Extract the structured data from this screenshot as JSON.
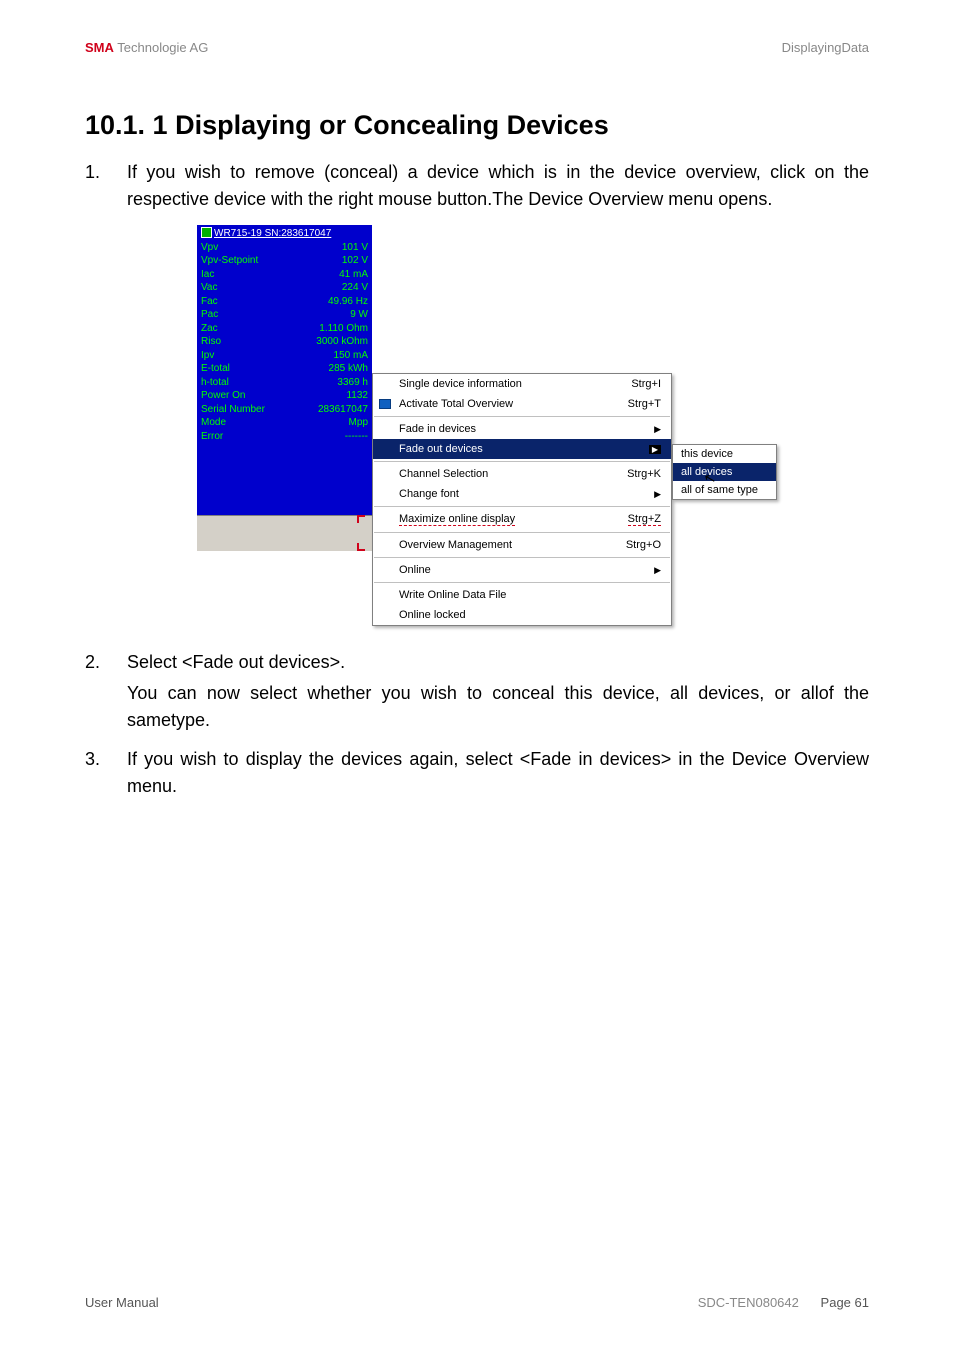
{
  "header": {
    "brand_bold": "SMA",
    "brand_rest": " Technologie AG",
    "right": "DisplayingData"
  },
  "title": "10.1. 1 Displaying or Concealing Devices",
  "steps": {
    "s1_num": "1.",
    "s1_text": "If you wish to remove (conceal) a device which is in the device overview, click on the respective device with the right mouse button.The Device Overview menu opens.",
    "s2_num": "2.",
    "s2_text": "Select <Fade out devices>.",
    "s2_sub": "You can now select whether you wish to conceal this device, all devices, or allof the sametype.",
    "s3_num": "3.",
    "s3_text": "If you wish to display the devices again, select <Fade in devices> in the Device Overview menu."
  },
  "device": {
    "title": "WR715-19 SN:283617047",
    "rows": [
      {
        "l": "Vpv",
        "r": "101 V"
      },
      {
        "l": "Vpv-Setpoint",
        "r": "102 V"
      },
      {
        "l": "Iac",
        "r": "41 mA"
      },
      {
        "l": "Vac",
        "r": "224 V"
      },
      {
        "l": "Fac",
        "r": "49.96 Hz"
      },
      {
        "l": "Pac",
        "r": "9 W"
      },
      {
        "l": "Zac",
        "r": "1.110 Ohm"
      },
      {
        "l": "Riso",
        "r": "3000 kOhm"
      },
      {
        "l": "Ipv",
        "r": "150 mA"
      },
      {
        "l": "E-total",
        "r": "285 kWh"
      },
      {
        "l": "h-total",
        "r": "3369 h"
      },
      {
        "l": "Power On",
        "r": "1132"
      },
      {
        "l": "Serial Number",
        "r": "283617047"
      },
      {
        "l": "Mode",
        "r": "Mpp"
      },
      {
        "l": "Error",
        "r": "-------"
      }
    ]
  },
  "menu": {
    "m1": {
      "label": "Single device information",
      "sc": "Strg+I"
    },
    "m2": {
      "label": "Activate Total Overview",
      "sc": "Strg+T"
    },
    "m3": {
      "label": "Fade in devices",
      "sc": ""
    },
    "m4": {
      "label": "Fade out devices",
      "sc": ""
    },
    "m5": {
      "label": "Channel Selection",
      "sc": "Strg+K"
    },
    "m6": {
      "label": "Change font",
      "sc": ""
    },
    "m7": {
      "label": "Maximize online display",
      "sc": "Strg+Z"
    },
    "m8": {
      "label": "Overview Management",
      "sc": "Strg+O"
    },
    "m9": {
      "label": "Online",
      "sc": ""
    },
    "m10": {
      "label": "Write Online Data File",
      "sc": ""
    },
    "m11": {
      "label": "Online locked",
      "sc": ""
    }
  },
  "submenu": {
    "i1": "this device",
    "i2": "all devices",
    "i3": "all of same type"
  },
  "footer": {
    "left": "User Manual",
    "mid": "SDC-TEN080642",
    "right_label": "Page ",
    "right_num": "61"
  }
}
